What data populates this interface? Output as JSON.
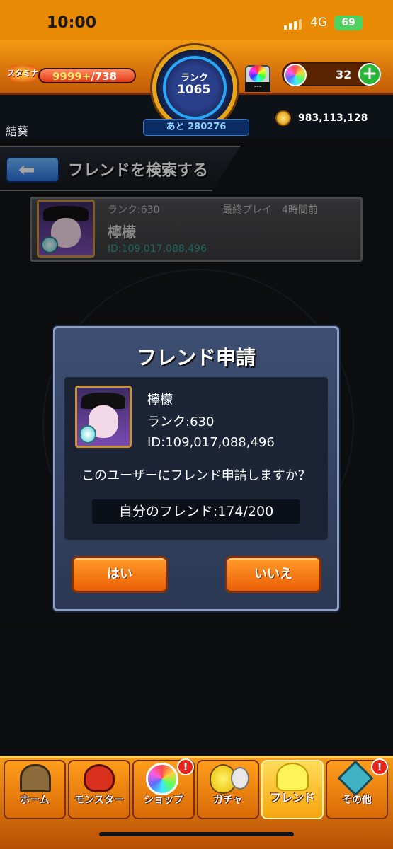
{
  "status_bar": {
    "time": "10:00",
    "network": "4G",
    "battery": "69"
  },
  "header": {
    "stamina_icon_label": "スタミナ",
    "stamina_current": "9999+",
    "stamina_max": "/738",
    "rank_label": "ランク",
    "rank_value": "1065",
    "rank_next": "あと 280276",
    "gem_machine_label": "---",
    "orb_count": "32",
    "orb_add": "+",
    "username": "結葵",
    "coin_count": "983,113,128"
  },
  "title_bar": {
    "back_arrow": "⬅",
    "title": "フレンドを検索する"
  },
  "user_card": {
    "rank": "ランク:630",
    "last_play": "最終プレイ　4時間前",
    "name": "檸檬",
    "id": "ID:109,017,088,496"
  },
  "modal": {
    "title": "フレンド申請",
    "name": "檸檬",
    "rank": "ランク:630",
    "id": "ID:109,017,088,496",
    "question": "このユーザーにフレンド申請しますか？",
    "friends_count": "自分のフレンド:174/200",
    "yes_label": "はい",
    "no_label": "いいえ"
  },
  "bottom_nav": {
    "items": [
      {
        "label": "ホーム",
        "icon": "home-gate-icon"
      },
      {
        "label": "モンスター",
        "icon": "dragon-icon"
      },
      {
        "label": "ショップ",
        "icon": "orb-icon",
        "badge": "!"
      },
      {
        "label": "ガチャ",
        "icon": "egg-icon"
      },
      {
        "label": "フレンド",
        "icon": "friends-icon"
      },
      {
        "label": "その他",
        "icon": "misc-icon",
        "badge": "!"
      }
    ]
  },
  "colors": {
    "accent_orange": "#ea5f05",
    "modal_bg": "#3d4f72",
    "rank_blue": "#27a9f7",
    "id_green": "#2f9c88"
  }
}
